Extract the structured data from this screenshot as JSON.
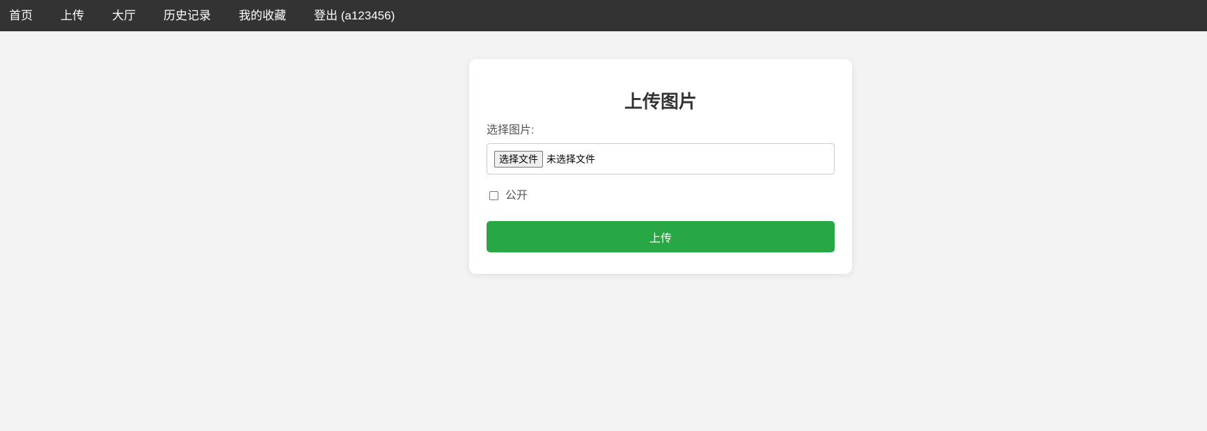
{
  "nav": {
    "items": [
      {
        "label": "首页"
      },
      {
        "label": "上传"
      },
      {
        "label": "大厅"
      },
      {
        "label": "历史记录"
      },
      {
        "label": "我的收藏"
      },
      {
        "label": "登出 (a123456)"
      }
    ]
  },
  "upload_form": {
    "title": "上传图片",
    "file_label": "选择图片:",
    "file_button_label": "选择文件",
    "file_status": "未选择文件",
    "public_checkbox": {
      "label": "公开",
      "checked": false
    },
    "submit_label": "上传"
  },
  "colors": {
    "navbar_bg": "#333333",
    "page_bg": "#f3f3f3",
    "submit_bg": "#28a745"
  }
}
